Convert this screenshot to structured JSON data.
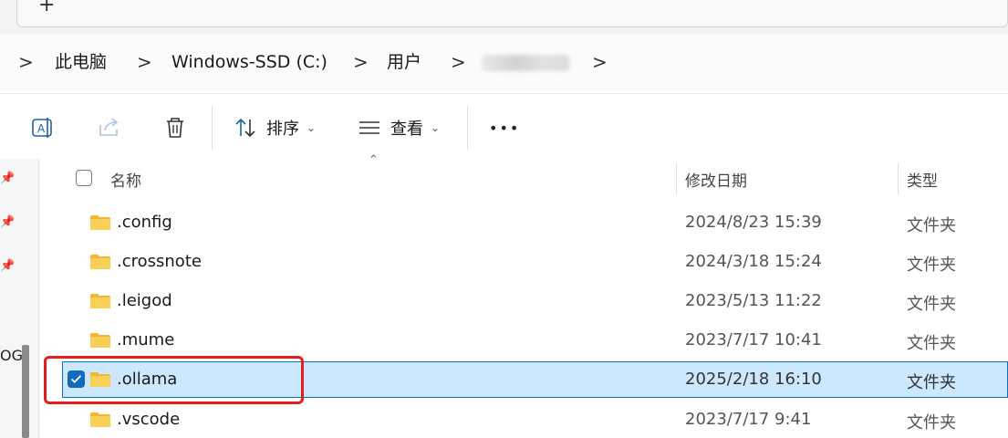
{
  "tabs": {
    "add_label": "+"
  },
  "breadcrumb": {
    "items": [
      {
        "label": "此电脑"
      },
      {
        "label": "Windows-SSD (C:)"
      },
      {
        "label": "用户"
      },
      {
        "label": ""
      }
    ],
    "separator": ">"
  },
  "toolbar": {
    "rename_icon": "rename-icon",
    "share_icon": "share-icon",
    "delete_icon": "trash-icon",
    "sort_label": "排序",
    "view_label": "查看",
    "more_label": "•••"
  },
  "file_list": {
    "columns": {
      "name": "名称",
      "date": "修改日期",
      "type": "类型"
    },
    "rows": [
      {
        "name": ".config",
        "date": "2024/8/23 15:39",
        "type": "文件夹",
        "selected": false
      },
      {
        "name": ".crossnote",
        "date": "2024/3/18 15:24",
        "type": "文件夹",
        "selected": false
      },
      {
        "name": ".leigod",
        "date": "2023/5/13 11:22",
        "type": "文件夹",
        "selected": false
      },
      {
        "name": ".mume",
        "date": "2023/7/17 10:41",
        "type": "文件夹",
        "selected": false
      },
      {
        "name": ".ollama",
        "date": "2025/2/18 16:10",
        "type": "文件夹",
        "selected": true
      },
      {
        "name": ".vscode",
        "date": "2023/7/17 9:41",
        "type": "文件夹",
        "selected": false
      }
    ]
  },
  "nav_pane": {
    "partial_label": "OG"
  },
  "colors": {
    "selection_bg": "#cce8ff",
    "selection_border": "#0f6cbd",
    "highlight_box": "#e02020",
    "folder_yellow": "#f7c948"
  }
}
